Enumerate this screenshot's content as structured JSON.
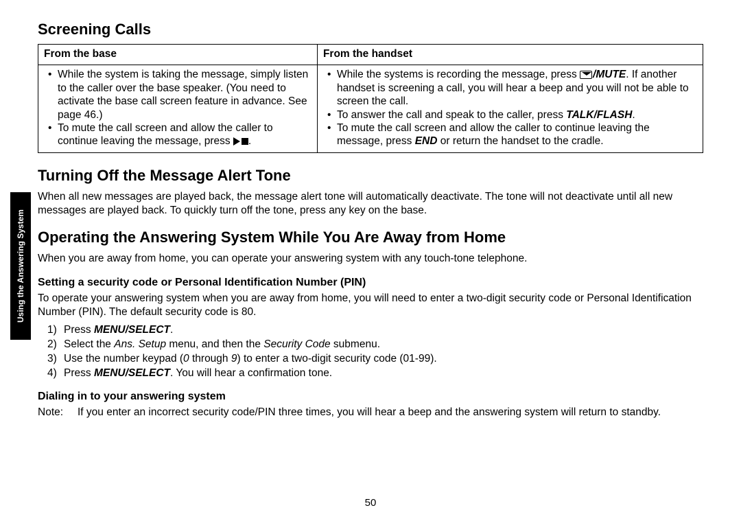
{
  "sideTab": "Using the Answering\nSystem",
  "heading1": "Screening Calls",
  "table": {
    "header_left": "From the base",
    "header_right": "From the handset",
    "left_b1": "While the system is taking the message, simply listen to the caller over the base speaker. (You need to activate the base call screen feature in advance. See page 46.)",
    "left_b2_pre": "To mute the call screen and allow the caller to continue leaving the message, press ",
    "left_b2_post": ".",
    "right_b1_pre": "While the systems is recording the message, press ",
    "right_b1_mute": "/MUTE",
    "right_b1_post": ". If another handset is screening a call, you will hear a beep and you will not be able to screen the call.",
    "right_b2_pre": "To answer the call and speak to the caller, press ",
    "right_b2_key": "TALK/FLASH",
    "right_b2_post": ".",
    "right_b3_pre": "To mute the call screen and allow the caller to continue leaving the message, press ",
    "right_b3_key": "END",
    "right_b3_post": " or return the handset to the cradle."
  },
  "heading2": "Turning Off the Message Alert Tone",
  "para2": "When all new messages are played back, the message alert tone will automatically deactivate. The tone will not deactivate until all new messages are played back. To quickly turn off the tone, press any key on the base.",
  "heading3": "Operating the Answering System While You Are Away from Home",
  "para3": "When you are away from home, you can operate your answering system with any touch-tone telephone.",
  "subA": "Setting a security code or Personal Identification Number (PIN)",
  "paraA": "To operate your answering system when you are away from home, you will need to enter a two-digit security code or Personal Identification Number (PIN). The default security code is 80.",
  "steps": {
    "s1_pre": "Press ",
    "s1_key": "MENU/SELECT",
    "s1_post": ".",
    "s2_pre": "Select the ",
    "s2_i1": "Ans. Setup",
    "s2_mid": " menu, and then the ",
    "s2_i2": "Security Code",
    "s2_post": " submenu.",
    "s3_pre": "Use the number keypad (",
    "s3_i1": "0",
    "s3_mid": " through ",
    "s3_i2": "9",
    "s3_post": ") to enter a two-digit security code (01-99).",
    "s4_pre": "Press ",
    "s4_key": "MENU/SELECT",
    "s4_post": ". You will hear a confirmation tone."
  },
  "subB": "Dialing in to your answering system",
  "noteLabel": "Note:",
  "noteText": "If you enter an incorrect security code/PIN three times, you will hear a beep and the answering system will return to standby.",
  "pageNum": "50"
}
